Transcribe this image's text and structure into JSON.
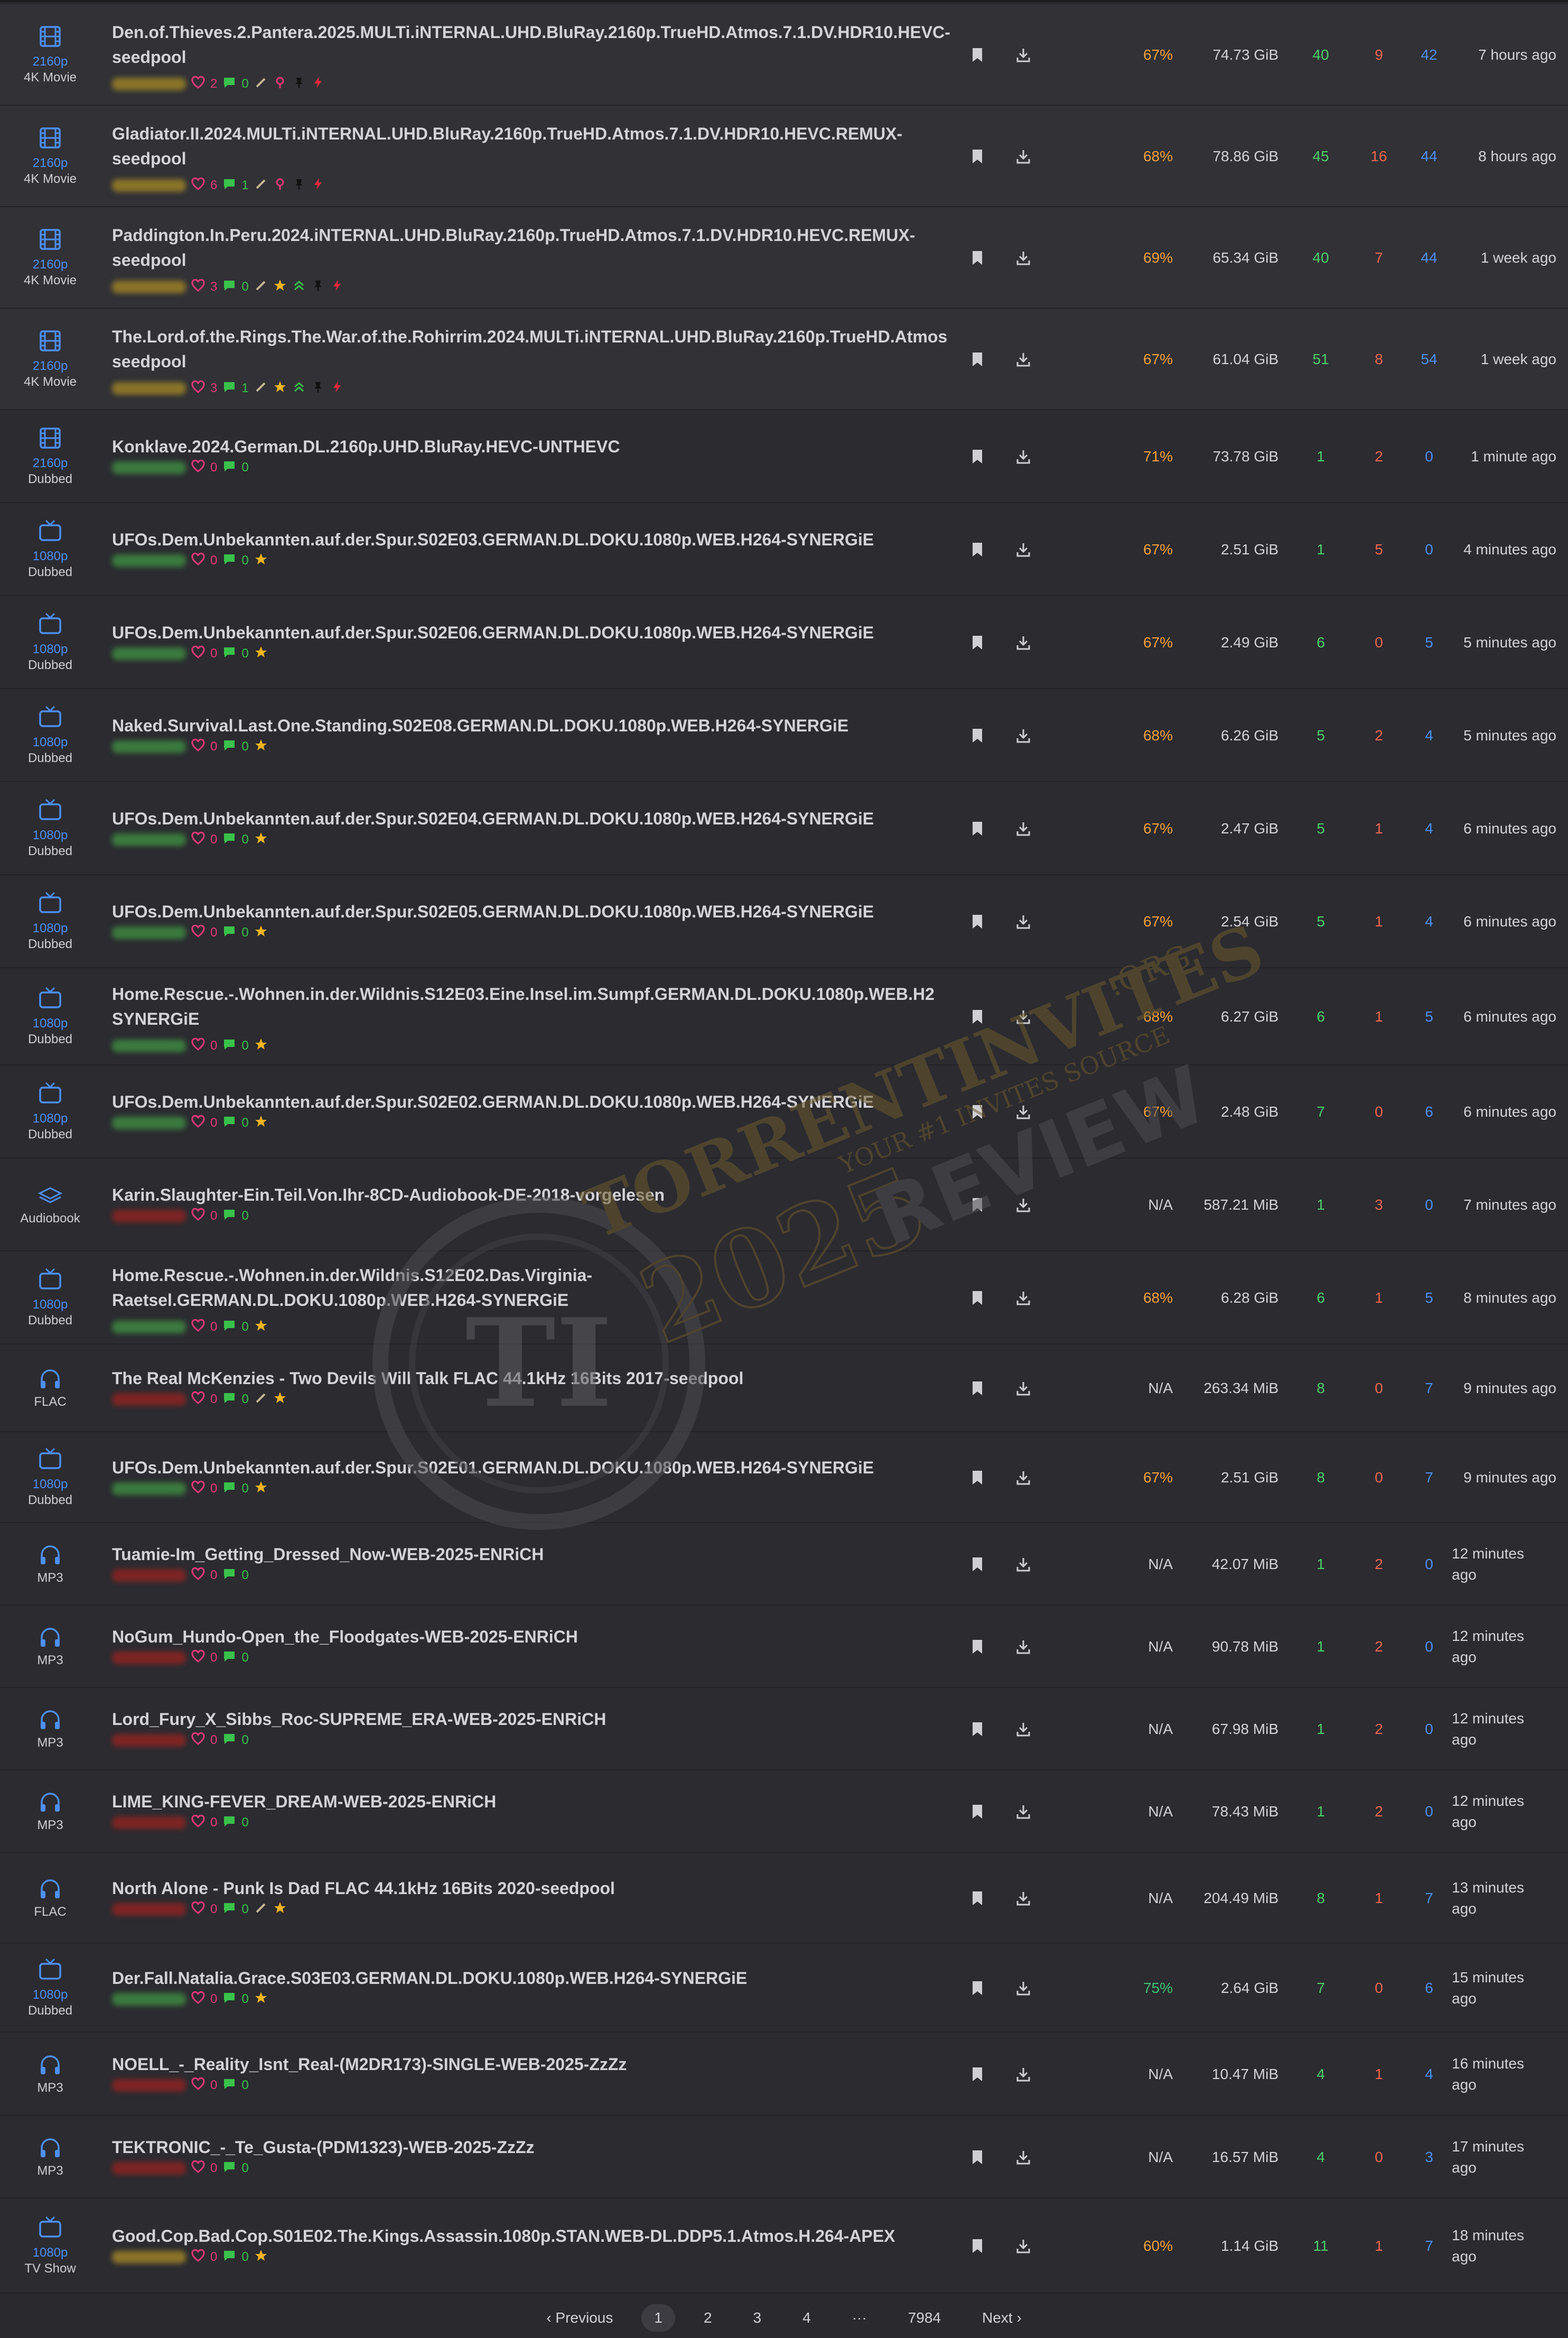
{
  "colors": {
    "res": "#4d8ff5",
    "seeders": "#4cd06b",
    "leechers": "#f2654f",
    "completed": "#4d8ff5",
    "percent_orange": "#f4a137",
    "percent_green": "#3cc273",
    "heart": "#e8367a",
    "comment": "#39c24a",
    "star": "#f3b51f"
  },
  "torrents": [
    {
      "cat_icon": "film-icon",
      "res": "2160p",
      "type": "4K Movie",
      "title": "Den.of.Thieves.2.Pantera.2025.MULTi.iNTERNAL.UHD.BluRay.2160p.TrueHD.Atmos.7.1.DV.HDR10.HEVC-\nseedpool",
      "uploader": "gold",
      "thanks": "2",
      "comments": "0",
      "badges": [
        "pencil-icon",
        "pill-icon",
        "pin-icon",
        "bolt-icon"
      ],
      "percent": "67%",
      "size": "74.73 GiB",
      "seeders": "40",
      "leechers": "9",
      "completed": "42",
      "age": "7 hours ago",
      "sticky": true,
      "two_line_title": true
    },
    {
      "cat_icon": "film-icon",
      "res": "2160p",
      "type": "4K Movie",
      "title": "Gladiator.II.2024.MULTi.iNTERNAL.UHD.BluRay.2160p.TrueHD.Atmos.7.1.DV.HDR10.HEVC.REMUX-\nseedpool",
      "uploader": "gold",
      "thanks": "6",
      "comments": "1",
      "badges": [
        "pencil-icon",
        "pill-icon",
        "pin-icon",
        "bolt-icon"
      ],
      "percent": "68%",
      "size": "78.86 GiB",
      "seeders": "45",
      "leechers": "16",
      "completed": "44",
      "age": "8 hours ago",
      "sticky": true,
      "two_line_title": true
    },
    {
      "cat_icon": "film-icon",
      "res": "2160p",
      "type": "4K Movie",
      "title": "Paddington.In.Peru.2024.iNTERNAL.UHD.BluRay.2160p.TrueHD.Atmos.7.1.DV.HDR10.HEVC.REMUX-\nseedpool",
      "uploader": "gold",
      "thanks": "3",
      "comments": "0",
      "badges": [
        "pencil-icon",
        "star-icon",
        "chevrons-up-icon",
        "pin-icon",
        "bolt-icon"
      ],
      "percent": "69%",
      "size": "65.34 GiB",
      "seeders": "40",
      "leechers": "7",
      "completed": "44",
      "age": "1 week ago",
      "sticky": true,
      "two_line_title": true
    },
    {
      "cat_icon": "film-icon",
      "res": "2160p",
      "type": "4K Movie",
      "title": "The.Lord.of.the.Rings.The.War.of.the.Rohirrim.2024.MULTi.iNTERNAL.UHD.BluRay.2160p.TrueHD.Atmos\nseedpool",
      "uploader": "gold",
      "thanks": "3",
      "comments": "1",
      "badges": [
        "pencil-icon",
        "star-icon",
        "chevrons-up-icon",
        "pin-icon",
        "bolt-icon"
      ],
      "percent": "67%",
      "size": "61.04 GiB",
      "seeders": "51",
      "leechers": "8",
      "completed": "54",
      "age": "1 week ago",
      "sticky": true,
      "two_line_title": true
    },
    {
      "cat_icon": "film-icon",
      "res": "2160p",
      "type": "Dubbed",
      "title": "Konklave.2024.German.DL.2160p.UHD.BluRay.HEVC-UNTHEVC",
      "uploader": "green",
      "thanks": "0",
      "comments": "0",
      "badges": [],
      "percent": "71%",
      "size": "73.78 GiB",
      "seeders": "1",
      "leechers": "2",
      "completed": "0",
      "age": "1 minute ago"
    },
    {
      "cat_icon": "tv-icon",
      "res": "1080p",
      "type": "Dubbed",
      "title": "UFOs.Dem.Unbekannten.auf.der.Spur.S02E03.GERMAN.DL.DOKU.1080p.WEB.H264-SYNERGiE",
      "uploader": "green",
      "thanks": "0",
      "comments": "0",
      "badges": [
        "star-icon"
      ],
      "percent": "67%",
      "size": "2.51 GiB",
      "seeders": "1",
      "leechers": "5",
      "completed": "0",
      "age": "4 minutes ago"
    },
    {
      "cat_icon": "tv-icon",
      "res": "1080p",
      "type": "Dubbed",
      "title": "UFOs.Dem.Unbekannten.auf.der.Spur.S02E06.GERMAN.DL.DOKU.1080p.WEB.H264-SYNERGiE",
      "uploader": "green",
      "thanks": "0",
      "comments": "0",
      "badges": [
        "star-icon"
      ],
      "percent": "67%",
      "size": "2.49 GiB",
      "seeders": "6",
      "leechers": "0",
      "completed": "5",
      "age": "5 minutes ago"
    },
    {
      "cat_icon": "tv-icon",
      "res": "1080p",
      "type": "Dubbed",
      "title": "Naked.Survival.Last.One.Standing.S02E08.GERMAN.DL.DOKU.1080p.WEB.H264-SYNERGiE",
      "uploader": "green",
      "thanks": "0",
      "comments": "0",
      "badges": [
        "star-icon"
      ],
      "percent": "68%",
      "size": "6.26 GiB",
      "seeders": "5",
      "leechers": "2",
      "completed": "4",
      "age": "5 minutes ago"
    },
    {
      "cat_icon": "tv-icon",
      "res": "1080p",
      "type": "Dubbed",
      "title": "UFOs.Dem.Unbekannten.auf.der.Spur.S02E04.GERMAN.DL.DOKU.1080p.WEB.H264-SYNERGiE",
      "uploader": "green",
      "thanks": "0",
      "comments": "0",
      "badges": [
        "star-icon"
      ],
      "percent": "67%",
      "size": "2.47 GiB",
      "seeders": "5",
      "leechers": "1",
      "completed": "4",
      "age": "6 minutes ago"
    },
    {
      "cat_icon": "tv-icon",
      "res": "1080p",
      "type": "Dubbed",
      "title": "UFOs.Dem.Unbekannten.auf.der.Spur.S02E05.GERMAN.DL.DOKU.1080p.WEB.H264-SYNERGiE",
      "uploader": "green",
      "thanks": "0",
      "comments": "0",
      "badges": [
        "star-icon"
      ],
      "percent": "67%",
      "size": "2.54 GiB",
      "seeders": "5",
      "leechers": "1",
      "completed": "4",
      "age": "6 minutes ago"
    },
    {
      "cat_icon": "tv-icon",
      "res": "1080p",
      "type": "Dubbed",
      "title": "Home.Rescue.-.Wohnen.in.der.Wildnis.S12E03.Eine.Insel.im.Sumpf.GERMAN.DL.DOKU.1080p.WEB.H2\nSYNERGiE",
      "uploader": "green",
      "thanks": "0",
      "comments": "0",
      "badges": [
        "star-icon"
      ],
      "percent": "68%",
      "size": "6.27 GiB",
      "seeders": "6",
      "leechers": "1",
      "completed": "5",
      "age": "6 minutes ago",
      "two_line_title": true
    },
    {
      "cat_icon": "tv-icon",
      "res": "1080p",
      "type": "Dubbed",
      "title": "UFOs.Dem.Unbekannten.auf.der.Spur.S02E02.GERMAN.DL.DOKU.1080p.WEB.H264-SYNERGiE",
      "uploader": "green",
      "thanks": "0",
      "comments": "0",
      "badges": [
        "star-icon"
      ],
      "percent": "67%",
      "size": "2.48 GiB",
      "seeders": "7",
      "leechers": "0",
      "completed": "6",
      "age": "6 minutes ago"
    },
    {
      "cat_icon": "audiobook-icon",
      "res": "",
      "type": "Audiobook",
      "title": "Karin.Slaughter-Ein.Teil.Von.Ihr-8CD-Audiobook-DE-2018-vorgelesen",
      "uploader": "red",
      "thanks": "0",
      "comments": "0",
      "badges": [],
      "percent": "N/A",
      "size": "587.21 MiB",
      "seeders": "1",
      "leechers": "3",
      "completed": "0",
      "age": "7 minutes ago"
    },
    {
      "cat_icon": "tv-icon",
      "res": "1080p",
      "type": "Dubbed",
      "title": "Home.Rescue.-.Wohnen.in.der.Wildnis.S12E02.Das.Virginia-\nRaetsel.GERMAN.DL.DOKU.1080p.WEB.H264-SYNERGiE",
      "uploader": "green",
      "thanks": "0",
      "comments": "0",
      "badges": [
        "star-icon"
      ],
      "percent": "68%",
      "size": "6.28 GiB",
      "seeders": "6",
      "leechers": "1",
      "completed": "5",
      "age": "8 minutes ago",
      "two_line_title": true
    },
    {
      "cat_icon": "headphones-icon",
      "res": "",
      "type": "FLAC",
      "title": "The Real McKenzies - Two Devils Will Talk FLAC 44.1kHz 16Bits 2017-seedpool",
      "uploader": "red",
      "thanks": "0",
      "comments": "0",
      "badges": [
        "pencil-icon",
        "star-icon"
      ],
      "percent": "N/A",
      "size": "263.34 MiB",
      "seeders": "8",
      "leechers": "0",
      "completed": "7",
      "age": "9 minutes ago"
    },
    {
      "cat_icon": "tv-icon",
      "res": "1080p",
      "type": "Dubbed",
      "title": "UFOs.Dem.Unbekannten.auf.der.Spur.S02E01.GERMAN.DL.DOKU.1080p.WEB.H264-SYNERGiE",
      "uploader": "green",
      "thanks": "0",
      "comments": "0",
      "badges": [
        "star-icon"
      ],
      "percent": "67%",
      "size": "2.51 GiB",
      "seeders": "8",
      "leechers": "0",
      "completed": "7",
      "age": "9 minutes ago"
    },
    {
      "cat_icon": "headphones-icon",
      "res": "",
      "type": "MP3",
      "title": "Tuamie-Im_Getting_Dressed_Now-WEB-2025-ENRiCH",
      "uploader": "red",
      "thanks": "0",
      "comments": "0",
      "badges": [],
      "percent": "N/A",
      "size": "42.07 MiB",
      "seeders": "1",
      "leechers": "2",
      "completed": "0",
      "age": "12 minutes\nago",
      "age_wrap": true
    },
    {
      "cat_icon": "headphones-icon",
      "res": "",
      "type": "MP3",
      "title": "NoGum_Hundo-Open_the_Floodgates-WEB-2025-ENRiCH",
      "uploader": "red",
      "thanks": "0",
      "comments": "0",
      "badges": [],
      "percent": "N/A",
      "size": "90.78 MiB",
      "seeders": "1",
      "leechers": "2",
      "completed": "0",
      "age": "12 minutes\nago",
      "age_wrap": true
    },
    {
      "cat_icon": "headphones-icon",
      "res": "",
      "type": "MP3",
      "title": "Lord_Fury_X_Sibbs_Roc-SUPREME_ERA-WEB-2025-ENRiCH",
      "uploader": "red",
      "thanks": "0",
      "comments": "0",
      "badges": [],
      "percent": "N/A",
      "size": "67.98 MiB",
      "seeders": "1",
      "leechers": "2",
      "completed": "0",
      "age": "12 minutes\nago",
      "age_wrap": true
    },
    {
      "cat_icon": "headphones-icon",
      "res": "",
      "type": "MP3",
      "title": "LIME_KING-FEVER_DREAM-WEB-2025-ENRiCH",
      "uploader": "red",
      "thanks": "0",
      "comments": "0",
      "badges": [],
      "percent": "N/A",
      "size": "78.43 MiB",
      "seeders": "1",
      "leechers": "2",
      "completed": "0",
      "age": "12 minutes\nago",
      "age_wrap": true
    },
    {
      "cat_icon": "headphones-icon",
      "res": "",
      "type": "FLAC",
      "title": "North Alone - Punk Is Dad FLAC 44.1kHz 16Bits 2020-seedpool",
      "uploader": "red",
      "thanks": "0",
      "comments": "0",
      "badges": [
        "pencil-icon",
        "star-icon"
      ],
      "percent": "N/A",
      "size": "204.49 MiB",
      "seeders": "8",
      "leechers": "1",
      "completed": "7",
      "age": "13 minutes\nago",
      "age_wrap": true
    },
    {
      "cat_icon": "tv-icon",
      "res": "1080p",
      "type": "Dubbed",
      "title": "Der.Fall.Natalia.Grace.S03E03.GERMAN.DL.DOKU.1080p.WEB.H264-SYNERGiE",
      "uploader": "green",
      "thanks": "0",
      "comments": "0",
      "badges": [
        "star-icon"
      ],
      "percent": "75%",
      "size": "2.64 GiB",
      "seeders": "7",
      "leechers": "0",
      "completed": "6",
      "age": "15 minutes\nago",
      "age_wrap": true,
      "pct_green": true
    },
    {
      "cat_icon": "headphones-icon",
      "res": "",
      "type": "MP3",
      "title": "NOELL_-_Reality_Isnt_Real-(M2DR173)-SINGLE-WEB-2025-ZzZz",
      "uploader": "red",
      "thanks": "0",
      "comments": "0",
      "badges": [],
      "percent": "N/A",
      "size": "10.47 MiB",
      "seeders": "4",
      "leechers": "1",
      "completed": "4",
      "age": "16 minutes\nago",
      "age_wrap": true
    },
    {
      "cat_icon": "headphones-icon",
      "res": "",
      "type": "MP3",
      "title": "TEKTRONIC_-_Te_Gusta-(PDM1323)-WEB-2025-ZzZz",
      "uploader": "red",
      "thanks": "0",
      "comments": "0",
      "badges": [],
      "percent": "N/A",
      "size": "16.57 MiB",
      "seeders": "4",
      "leechers": "0",
      "completed": "3",
      "age": "17 minutes\nago",
      "age_wrap": true
    },
    {
      "cat_icon": "tv-icon",
      "res": "1080p",
      "type": "TV Show",
      "title": "Good.Cop.Bad.Cop.S01E02.The.Kings.Assassin.1080p.STAN.WEB-DL.DDP5.1.Atmos.H.264-APEX",
      "uploader": "gold",
      "thanks": "0",
      "comments": "0",
      "badges": [
        "star-icon"
      ],
      "percent": "60%",
      "size": "1.14 GiB",
      "seeders": "11",
      "leechers": "1",
      "completed": "7",
      "age": "18 minutes\nago",
      "age_wrap": true
    }
  ],
  "pagination": {
    "previous": "‹ Previous",
    "pages": [
      "1",
      "2",
      "3",
      "4"
    ],
    "ellipsis": "···",
    "last": "7984",
    "next": "Next ›",
    "current": "1"
  },
  "watermark": {
    "line1": "TORRENTINVITES",
    "line2": ".ORG",
    "tagline": "YOUR #1 INVITES SOURCE",
    "year": "2025",
    "word": "REVIEW",
    "monogram": "TI"
  }
}
